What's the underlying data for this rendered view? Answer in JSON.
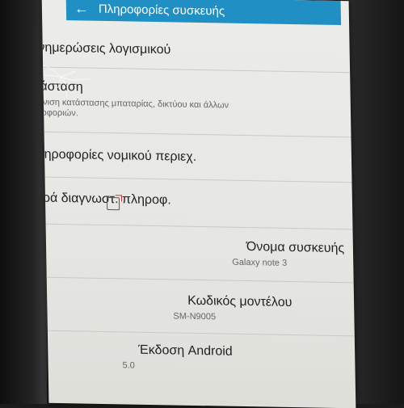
{
  "header": {
    "back_icon": "arrow-left-icon",
    "title": "Πληροφορίες συσκευής",
    "background_color": "#1f8fc4"
  },
  "rows": [
    {
      "title": "Ενημερώσεις λογισμικού"
    },
    {
      "title": "Κατάσταση",
      "subtitle": "Εμφάνιση κατάστασης μπαταρίας, δικτύου και άλλων πληροφοριών."
    },
    {
      "title": "Πληροφορίες νομικού περιεχ."
    },
    {
      "title": "Αναφορά διαγνωστ. πληροφ.",
      "icon": "external-link-icon"
    },
    {
      "title": "Όνομα συσκευής",
      "subtitle": "Galaxy note 3"
    },
    {
      "title": "Κωδικός μοντέλου",
      "subtitle": "SM-N9005"
    },
    {
      "title": "Έκδοση Android",
      "subtitle": "5.0"
    }
  ]
}
